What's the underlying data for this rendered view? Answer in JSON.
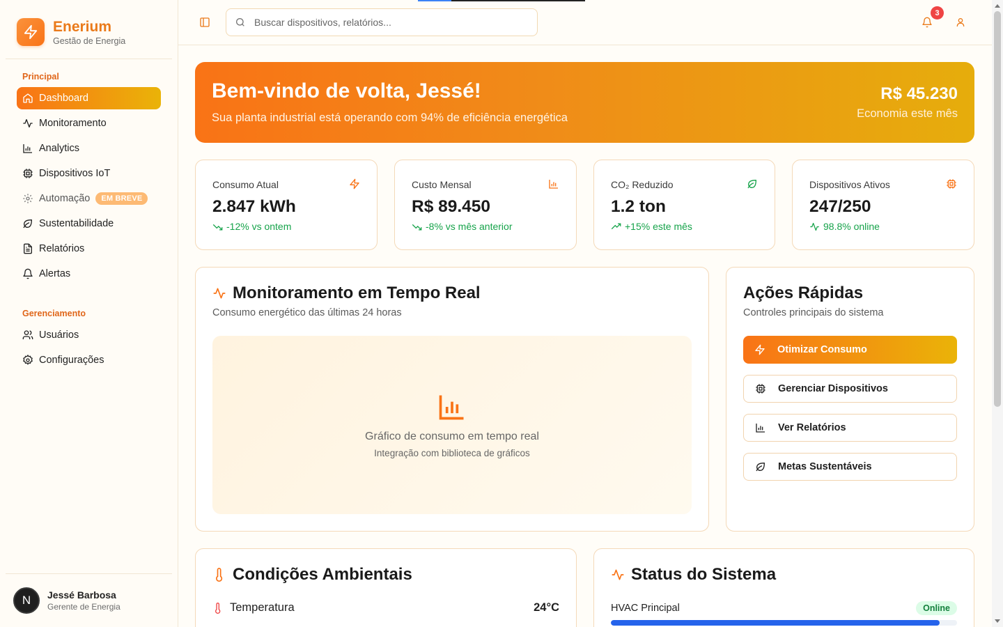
{
  "brand": {
    "name": "Enerium",
    "subtitle": "Gestão de Energia"
  },
  "sidebar": {
    "groups": [
      {
        "label": "Principal"
      },
      {
        "label": "Gerenciamento"
      }
    ],
    "items": [
      {
        "label": "Dashboard",
        "icon": "home-icon",
        "active": true
      },
      {
        "label": "Monitoramento",
        "icon": "activity-icon"
      },
      {
        "label": "Analytics",
        "icon": "bar-chart-icon"
      },
      {
        "label": "Dispositivos IoT",
        "icon": "cpu-icon"
      },
      {
        "label": "Automação",
        "icon": "gear-icon",
        "badge": "EM BREVE"
      },
      {
        "label": "Sustentabilidade",
        "icon": "leaf-icon"
      },
      {
        "label": "Relatórios",
        "icon": "file-text-icon"
      },
      {
        "label": "Alertas",
        "icon": "bell-icon"
      },
      {
        "label": "Usuários",
        "icon": "users-icon"
      },
      {
        "label": "Configurações",
        "icon": "settings-icon"
      }
    ]
  },
  "user": {
    "initial": "N",
    "name": "Jessé Barbosa",
    "role": "Gerente de Energia"
  },
  "header": {
    "search_placeholder": "Buscar dispositivos, relatórios...",
    "notification_count": "3"
  },
  "hero": {
    "title": "Bem-vindo de volta, Jessé!",
    "subtitle": "Sua planta industrial está operando com 94% de eficiência energética",
    "amount": "R$ 45.230",
    "amount_label": "Economia este mês"
  },
  "stats": [
    {
      "title": "Consumo Atual",
      "value": "2.847 kWh",
      "delta": "-12% vs ontem",
      "icon": "zap-icon",
      "trend": "down"
    },
    {
      "title": "Custo Mensal",
      "value": "R$ 89.450",
      "delta": "-8% vs mês anterior",
      "icon": "bar-chart-icon",
      "trend": "down"
    },
    {
      "title": "CO₂ Reduzido",
      "value": "1.2 ton",
      "delta": "+15% este mês",
      "icon": "leaf-icon",
      "trend": "up"
    },
    {
      "title": "Dispositivos Ativos",
      "value": "247/250",
      "delta": "98.8% online",
      "icon": "cpu-icon",
      "trend": "pulse"
    }
  ],
  "monitor": {
    "title": "Monitoramento em Tempo Real",
    "subtitle": "Consumo energético das últimas 24 horas",
    "placeholder_title": "Gráfico de consumo em tempo real",
    "placeholder_sub": "Integração com biblioteca de gráficos"
  },
  "quick_actions": {
    "title": "Ações Rápidas",
    "subtitle": "Controles principais do sistema",
    "buttons": [
      {
        "label": "Otimizar Consumo",
        "icon": "zap-icon"
      },
      {
        "label": "Gerenciar Dispositivos",
        "icon": "cpu-icon"
      },
      {
        "label": "Ver Relatórios",
        "icon": "bar-chart-icon"
      },
      {
        "label": "Metas Sustentáveis",
        "icon": "leaf-icon"
      }
    ]
  },
  "environment": {
    "title": "Condições Ambientais",
    "rows": [
      {
        "label": "Temperatura",
        "value": "24°C"
      }
    ]
  },
  "system": {
    "title": "Status do Sistema",
    "rows": [
      {
        "label": "HVAC Principal",
        "status": "Online",
        "level": 0.95
      }
    ]
  },
  "colors": {
    "accent": "#f97316",
    "accent_end": "#eab308",
    "success": "#16a34a",
    "danger": "#ef4444",
    "progress": "#2563eb"
  }
}
